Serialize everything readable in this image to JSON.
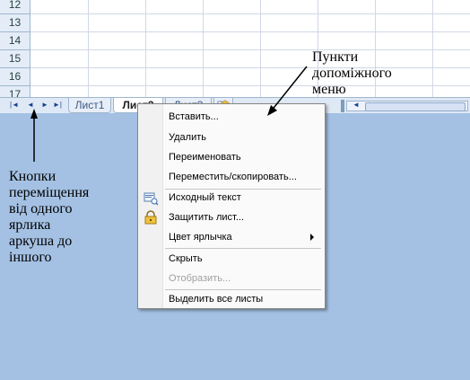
{
  "rows": [
    "12",
    "13",
    "14",
    "15",
    "16",
    "17"
  ],
  "nav_buttons": [
    "|◄",
    "◄",
    "►",
    "►|"
  ],
  "tabs": [
    {
      "label": "Лист1",
      "active": false
    },
    {
      "label": "Лист2",
      "active": true
    },
    {
      "label": "Лист3",
      "active": false
    }
  ],
  "context_menu": {
    "items": [
      {
        "label": "Вставить...",
        "enabled": true
      },
      {
        "label": "Удалить",
        "enabled": true
      },
      {
        "label": "Переименовать",
        "enabled": true
      },
      {
        "label": "Переместить/скопировать...",
        "enabled": true
      },
      {
        "label": "Исходный текст",
        "enabled": true,
        "icon": "view-code-icon"
      },
      {
        "label": "Защитить лист...",
        "enabled": true,
        "icon": "lock-icon"
      },
      {
        "label": "Цвет ярлычка",
        "enabled": true,
        "submenu": true
      },
      {
        "label": "Скрыть",
        "enabled": true
      },
      {
        "label": "Отобразить...",
        "enabled": false
      },
      {
        "label": "Выделить все листы",
        "enabled": true
      }
    ]
  },
  "annotations": {
    "left": "Кнопки\nпереміщення\nвід одного\nярлика\nаркуша до\nіншого",
    "right": "Пункти\nдопоміжного\nменю"
  },
  "colors": {
    "background": "#a4c1e3",
    "menu_background": "#fafafa"
  }
}
